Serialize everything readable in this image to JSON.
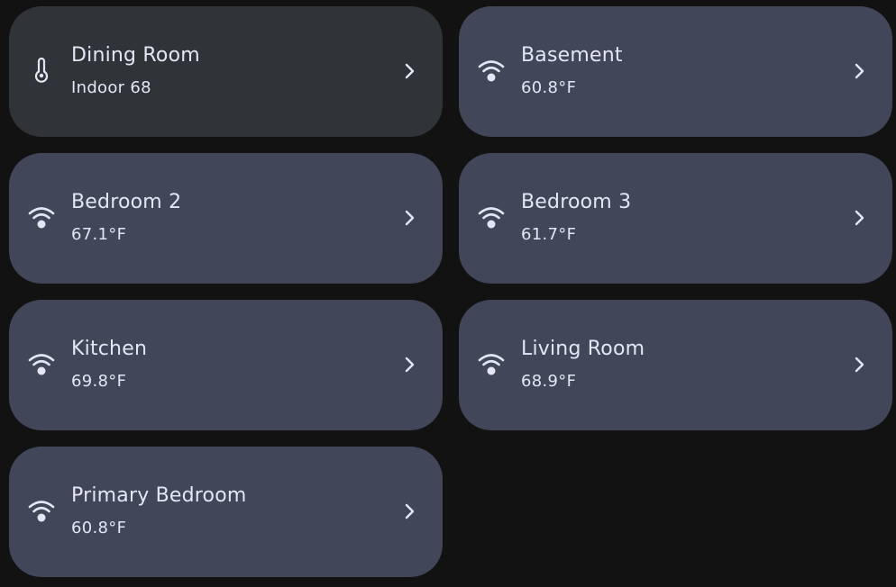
{
  "colors": {
    "background": "#121212",
    "tile": "#414659",
    "tile_dark": "#303338",
    "text": "#e4e6f4"
  },
  "tiles": [
    {
      "title": "Dining Room",
      "subtitle": "Indoor 68",
      "icon": "thermometer-icon",
      "style": "dark"
    },
    {
      "title": "Basement",
      "subtitle": "60.8°F",
      "icon": "wifi-sensor-icon"
    },
    {
      "title": "Bedroom 2",
      "subtitle": "67.1°F",
      "icon": "wifi-sensor-icon"
    },
    {
      "title": "Bedroom 3",
      "subtitle": "61.7°F",
      "icon": "wifi-sensor-icon"
    },
    {
      "title": "Kitchen",
      "subtitle": "69.8°F",
      "icon": "wifi-sensor-icon"
    },
    {
      "title": "Living Room",
      "subtitle": "68.9°F",
      "icon": "wifi-sensor-icon"
    },
    {
      "title": "Primary Bedroom",
      "subtitle": "60.8°F",
      "icon": "wifi-sensor-icon"
    }
  ]
}
